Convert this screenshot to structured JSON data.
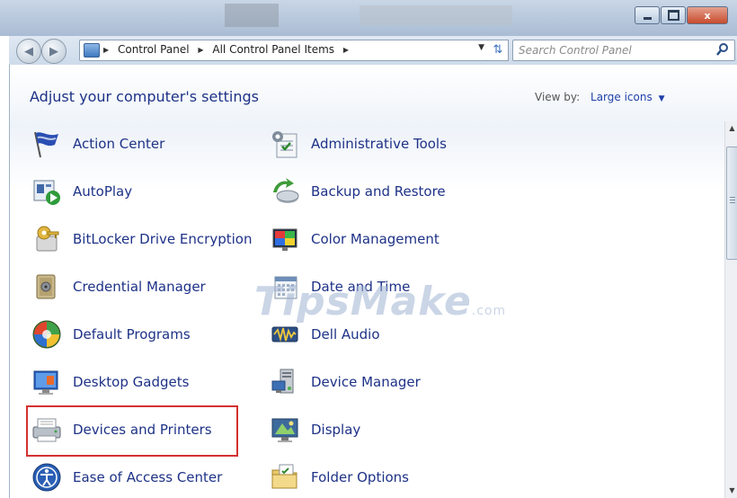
{
  "window": {
    "minimize_label": "",
    "maximize_label": "",
    "close_label": "x"
  },
  "nav": {
    "breadcrumbs": [
      "Control Panel",
      "All Control Panel Items"
    ],
    "search_placeholder": "Search Control Panel"
  },
  "header": {
    "title": "Adjust your computer's settings",
    "view_by_label": "View by:",
    "view_by_value": "Large icons"
  },
  "items": [
    {
      "label": "Action Center",
      "icon": "flag-icon"
    },
    {
      "label": "Administrative Tools",
      "icon": "admin-tools-icon"
    },
    {
      "label": "AutoPlay",
      "icon": "autoplay-icon"
    },
    {
      "label": "Backup and Restore",
      "icon": "backup-icon"
    },
    {
      "label": "BitLocker Drive Encryption",
      "icon": "key-icon"
    },
    {
      "label": "Color Management",
      "icon": "color-management-icon"
    },
    {
      "label": "Credential Manager",
      "icon": "vault-icon"
    },
    {
      "label": "Date and Time",
      "icon": "calendar-clock-icon"
    },
    {
      "label": "Default Programs",
      "icon": "windows-orb-icon"
    },
    {
      "label": "Dell Audio",
      "icon": "audio-wave-icon"
    },
    {
      "label": "Desktop Gadgets",
      "icon": "gadgets-icon"
    },
    {
      "label": "Device Manager",
      "icon": "device-manager-icon"
    },
    {
      "label": "Devices and Printers",
      "icon": "printer-icon"
    },
    {
      "label": "Display",
      "icon": "monitor-icon"
    },
    {
      "label": "Ease of Access Center",
      "icon": "accessibility-icon"
    },
    {
      "label": "Folder Options",
      "icon": "folder-icon"
    }
  ],
  "highlighted_item": "Devices and Printers",
  "watermark": {
    "brand": "TipsMake",
    "suffix": ".com"
  },
  "colors": {
    "link_text": "#1e3287",
    "highlight_box": "#d43030"
  }
}
